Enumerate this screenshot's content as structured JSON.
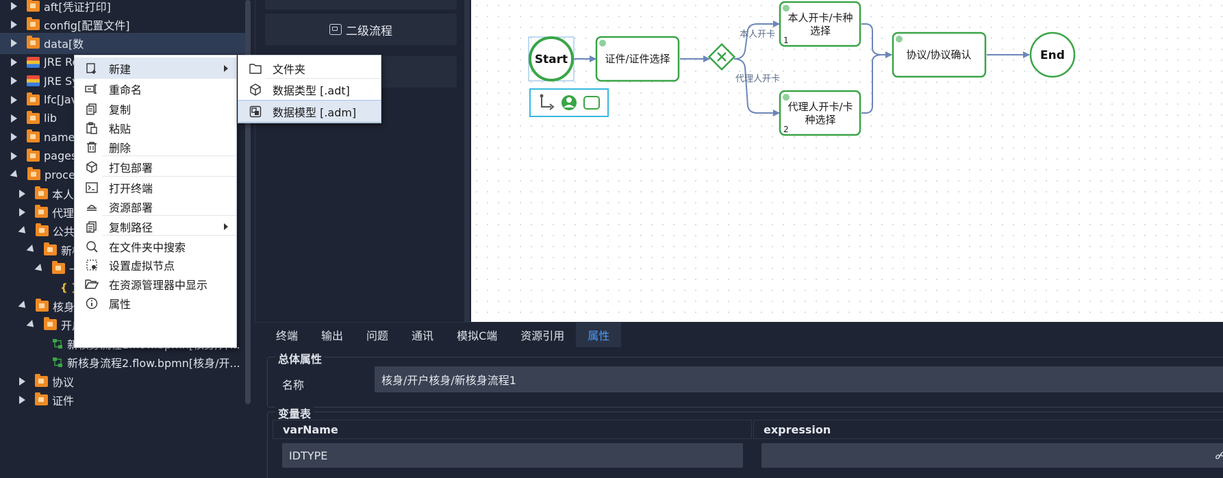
{
  "sidebar": {
    "items": [
      {
        "label": "aft[凭证打印]",
        "icon": "folder-icon",
        "expand": "right",
        "indent": 0
      },
      {
        "label": "config[配置文件]",
        "icon": "folder-icon",
        "expand": "right",
        "indent": 0
      },
      {
        "label": "data[数",
        "icon": "folder-icon",
        "expand": "right",
        "indent": 0,
        "selected": true
      },
      {
        "label": "JRE Re",
        "icon": "jre-icon",
        "expand": "right",
        "indent": 0
      },
      {
        "label": "JRE Sy",
        "icon": "jre-icon",
        "expand": "right",
        "indent": 0
      },
      {
        "label": "lfc[Java",
        "icon": "folder-icon",
        "expand": "right",
        "indent": 0
      },
      {
        "label": "lib",
        "icon": "folder-icon",
        "expand": "right",
        "indent": 0
      },
      {
        "label": "names",
        "icon": "folder-icon",
        "expand": "right",
        "indent": 0
      },
      {
        "label": "pages",
        "icon": "folder-icon",
        "expand": "right",
        "indent": 0
      },
      {
        "label": "proces",
        "icon": "folder-icon",
        "expand": "down",
        "indent": 0
      },
      {
        "label": "本人开",
        "icon": "folder-icon",
        "expand": "right",
        "indent": 1
      },
      {
        "label": "代理人",
        "icon": "folder-icon",
        "expand": "right",
        "indent": 1
      },
      {
        "label": "公共",
        "icon": "folder-icon",
        "expand": "down",
        "indent": 1
      },
      {
        "label": "新核",
        "icon": "folder-icon",
        "expand": "down",
        "indent": 2
      },
      {
        "label": "一",
        "icon": "folder-icon",
        "expand": "down",
        "indent": 3
      },
      {
        "label": "",
        "icon": "json-icon",
        "expand": "none",
        "indent": 4
      },
      {
        "label": "核身",
        "icon": "folder-icon",
        "expand": "down",
        "indent": 1
      },
      {
        "label": "开户核身",
        "icon": "folder-icon",
        "expand": "down",
        "indent": 2
      },
      {
        "label": "新核身流程1.flow.bpmn[核身/开...",
        "icon": "flow-icon",
        "expand": "none",
        "indent": 3
      },
      {
        "label": "新核身流程2.flow.bpmn[核身/开...",
        "icon": "flow-icon",
        "expand": "none",
        "indent": 3
      },
      {
        "label": "协议",
        "icon": "folder-icon",
        "expand": "right",
        "indent": 1
      },
      {
        "label": "证件",
        "icon": "folder-icon",
        "expand": "right",
        "indent": 1
      }
    ]
  },
  "middle": {
    "buttons": [
      "二级流程",
      ""
    ]
  },
  "context_menu": {
    "items": [
      {
        "label": "新建",
        "icon": "new-file-icon",
        "submenu": true,
        "hover": true
      },
      {
        "label": "重命名",
        "icon": "rename-icon"
      },
      {
        "label": "复制",
        "icon": "copy-icon"
      },
      {
        "label": "粘贴",
        "icon": "paste-icon"
      },
      {
        "label": "删除",
        "icon": "trash-icon"
      },
      {
        "label": "打包部署",
        "icon": "package-icon"
      },
      {
        "label": "打开终端",
        "icon": "terminal-icon"
      },
      {
        "label": "资源部署",
        "icon": "deploy-icon"
      },
      {
        "label": "复制路径",
        "icon": "copy-path-icon",
        "submenu": true
      },
      {
        "label": "在文件夹中搜索",
        "icon": "search-icon"
      },
      {
        "label": "设置虚拟节点",
        "icon": "virtual-node-icon"
      },
      {
        "label": "在资源管理器中显示",
        "icon": "open-folder-icon"
      },
      {
        "label": "属性",
        "icon": "info-icon"
      }
    ]
  },
  "submenu": {
    "items": [
      {
        "label": "文件夹",
        "icon": "folder-outline-icon"
      },
      {
        "label": "数据类型 [.adt]",
        "icon": "cube-icon"
      },
      {
        "label": "数据模型 [.adm]",
        "icon": "model-icon",
        "hover": true
      }
    ]
  },
  "diagram": {
    "start": "Start",
    "end": "End",
    "task1": "证件/证件选择",
    "task_self_line1": "本人开卡/卡种",
    "task_self_line2": "选择",
    "task_self_num": "1",
    "task_agent_line1": "代理人开卡/卡",
    "task_agent_line2": "种选择",
    "task_agent_num": "2",
    "task_confirm": "协议/协议确认",
    "edge_self": "本人开卡",
    "edge_agent": "代理人开卡",
    "accent": "#3aa547",
    "edge_color": "#6b86b8"
  },
  "bottom": {
    "tabs": [
      {
        "label": "终端"
      },
      {
        "label": "输出"
      },
      {
        "label": "问题"
      },
      {
        "label": "通讯"
      },
      {
        "label": "模拟C端"
      },
      {
        "label": "资源引用"
      },
      {
        "label": "属性",
        "active": true
      }
    ],
    "general_title": "总体属性",
    "name_label": "名称",
    "name_value": "核身/开户核身/新核身流程1",
    "var_title": "变量表",
    "col_varname": "varName",
    "col_expression": "expression",
    "rows": [
      {
        "varName": "IDTYPE",
        "expression": ""
      }
    ]
  }
}
